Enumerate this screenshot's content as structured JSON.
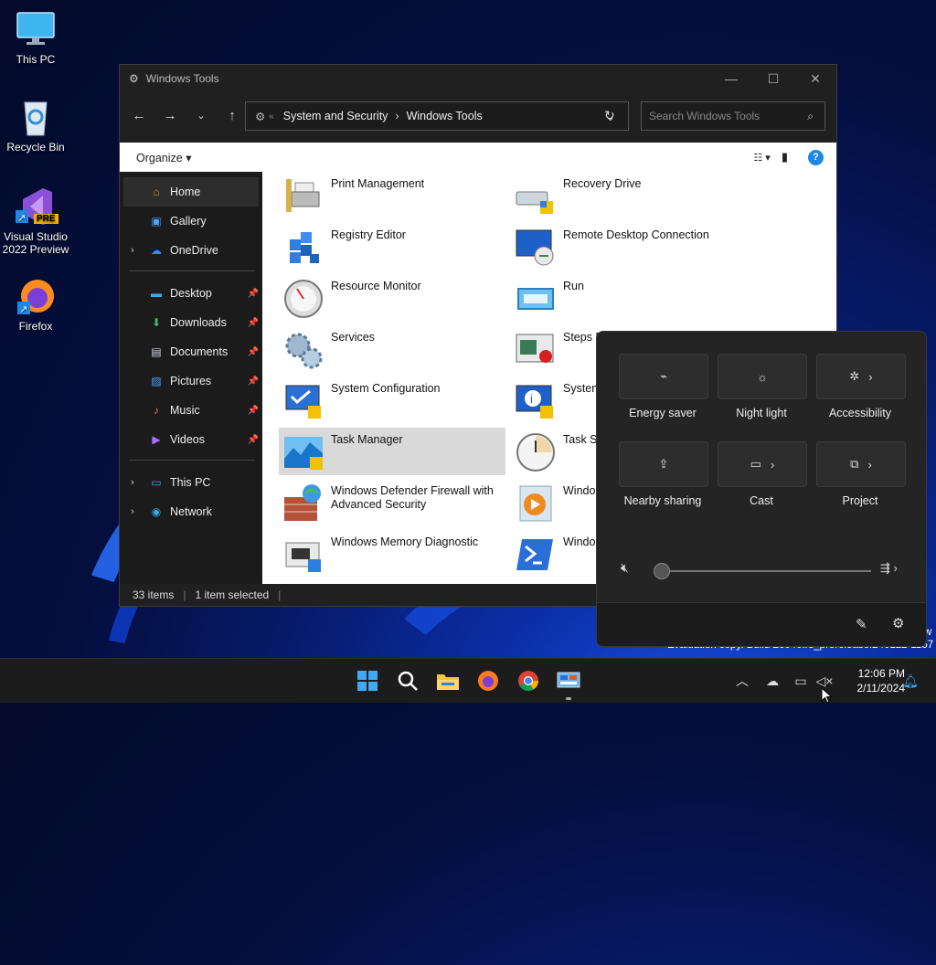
{
  "desktop": {
    "icons": [
      {
        "label": "This PC"
      },
      {
        "label": "Recycle Bin"
      },
      {
        "label": "Visual Studio 2022 Preview",
        "badge": "PRE"
      },
      {
        "label": "Firefox"
      }
    ]
  },
  "window": {
    "title": "Windows Tools",
    "breadcrumb": [
      "System and Security",
      "Windows Tools"
    ],
    "search_placeholder": "Search Windows Tools",
    "organize_label": "Organize"
  },
  "sidebar": {
    "items": [
      {
        "label": "Home"
      },
      {
        "label": "Gallery"
      },
      {
        "label": "OneDrive"
      },
      {
        "label": "Desktop"
      },
      {
        "label": "Downloads"
      },
      {
        "label": "Documents"
      },
      {
        "label": "Pictures"
      },
      {
        "label": "Music"
      },
      {
        "label": "Videos"
      },
      {
        "label": "This PC"
      },
      {
        "label": "Network"
      }
    ]
  },
  "files": {
    "left": [
      {
        "label": "Print Management"
      },
      {
        "label": "Registry Editor"
      },
      {
        "label": "Resource Monitor"
      },
      {
        "label": "Services"
      },
      {
        "label": "System Configuration"
      },
      {
        "label": "Task Manager",
        "selected": true
      },
      {
        "label": "Windows Defender Firewall with Advanced Security"
      },
      {
        "label": "Windows Memory Diagnostic"
      }
    ],
    "right": [
      {
        "label": "Recovery Drive"
      },
      {
        "label": "Remote Desktop Connection"
      },
      {
        "label": "Run"
      },
      {
        "label": "Steps R"
      },
      {
        "label": "System"
      },
      {
        "label": "Task Sc"
      },
      {
        "label": "Windo"
      },
      {
        "label": "Windo"
      }
    ]
  },
  "status": {
    "count": "33 items",
    "selection": "1 item selected"
  },
  "quick_settings": {
    "tiles": [
      {
        "label": "Energy saver"
      },
      {
        "label": "Night light"
      },
      {
        "label": "Accessibility"
      },
      {
        "label": "Nearby sharing"
      },
      {
        "label": "Cast"
      },
      {
        "label": "Project"
      }
    ],
    "volume_percent": 0
  },
  "watermark": "Evaluation copy. Build 26040.rs_prerelease.240122-1157",
  "watermark_top": "w",
  "clock": {
    "time": "12:06 PM",
    "date": "2/11/2024"
  },
  "colors": {
    "accent": "#0078d4",
    "window_bg": "#202020",
    "selected_item": "#d9d9d9"
  }
}
